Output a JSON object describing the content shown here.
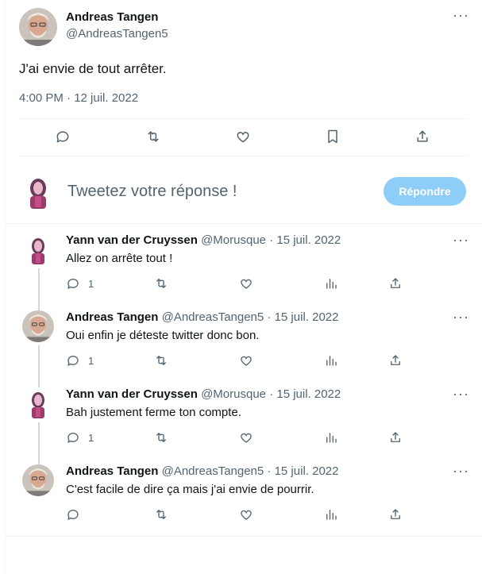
{
  "main_tweet": {
    "author_name": "Andreas Tangen",
    "author_handle": "@AndreasTangen5",
    "text": "J'ai envie de tout arrêter.",
    "timestamp": "4:00 PM · 12 juil. 2022"
  },
  "compose": {
    "placeholder": "Tweetez votre réponse !",
    "button_label": "Répondre"
  },
  "replies": [
    {
      "name": "Yann van der Cruyssen",
      "handle": "@Morusque",
      "date": "· 15 juil. 2022",
      "text": "Allez on arrête tout !",
      "reply_count": "1"
    },
    {
      "name": "Andreas Tangen",
      "handle": "@AndreasTangen5",
      "date": "· 15 juil. 2022",
      "text": "Oui enfin je déteste twitter donc bon.",
      "reply_count": "1"
    },
    {
      "name": "Yann van der Cruyssen",
      "handle": "@Morusque",
      "date": "· 15 juil. 2022",
      "text": "Bah justement ferme ton compte.",
      "reply_count": "1"
    },
    {
      "name": "Andreas Tangen",
      "handle": "@AndreasTangen5",
      "date": "· 15 juil. 2022",
      "text": "C'est facile de dire ça mais j'ai envie de pourrir.",
      "reply_count": ""
    }
  ],
  "colors": {
    "accent_disabled": "#8ecdf8",
    "secondary_text": "#536471",
    "border": "#eff3f4"
  }
}
